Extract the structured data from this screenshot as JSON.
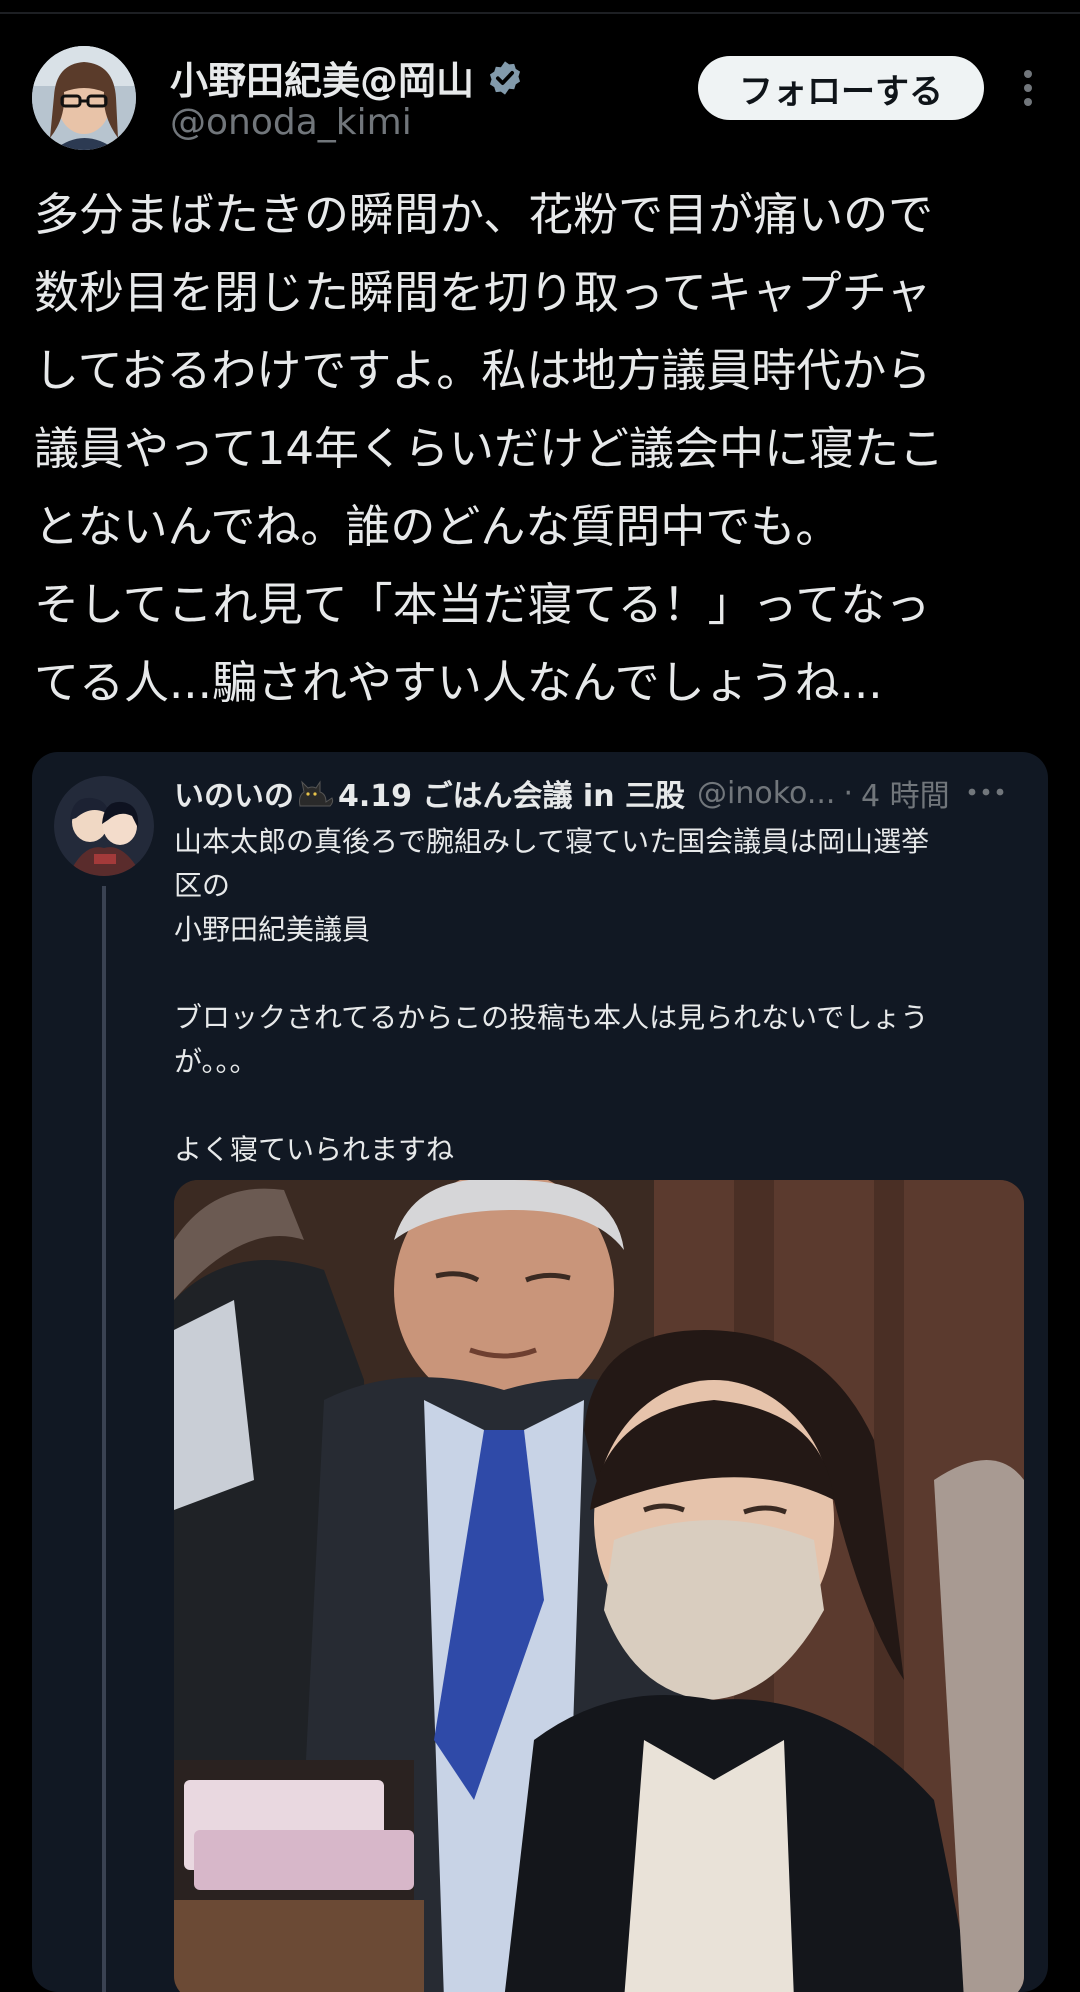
{
  "tweet": {
    "author_name": "小野田紀美@岡山",
    "handle": "@onoda_kimi",
    "follow_label": "フォローする",
    "text_lines": [
      "多分まばたきの瞬間か、花粉で目が痛いので",
      "数秒目を閉じた瞬間を切り取ってキャプチャ",
      "しておるわけですよ。私は地方議員時代から",
      "議員やって14年くらいだけど議会中に寝たこ",
      "とないんでね。誰のどんな質問中でも。",
      "そしてこれ見て「本当だ寝てる！」ってなっ",
      "てる人...騙されやすい人なんでしょうね..."
    ]
  },
  "quote": {
    "name_before": "いのいの",
    "name_after": "4.19 ごはん会議 in 三股",
    "handle": "@inoko...",
    "separator": "·",
    "time": "4 時間",
    "text_lines": [
      "山本太郎の真後ろで腕組みして寝ていた国会議員は岡山選挙",
      "区の",
      "小野田紀美議員",
      "",
      "ブロックされてるからこの投稿も本人は見られないでしょう",
      "が。。。",
      "",
      "よく寝ていられますね"
    ]
  },
  "icons": {
    "verified": "verified-badge-icon",
    "more_vertical": "more-vertical-icon",
    "more_horizontal": "more-horizontal-icon",
    "cat_emoji": "black-cat-icon"
  },
  "colors": {
    "background": "#000000",
    "card": "#111823",
    "text": "#e7e9ea",
    "secondary": "#71767b",
    "verified": "#829aab",
    "button_bg": "#eff3f4"
  }
}
